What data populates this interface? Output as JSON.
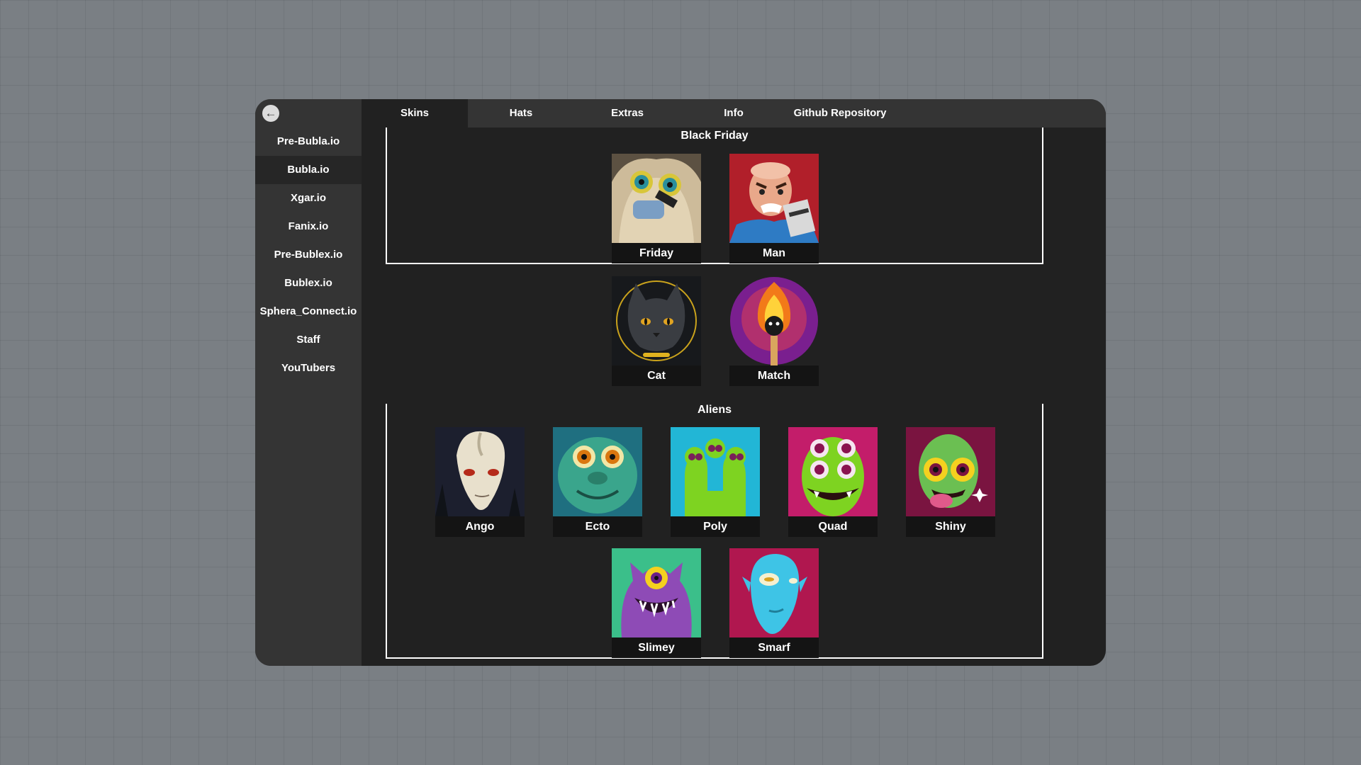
{
  "sidebar": {
    "back_icon": "arrow-left-icon",
    "items": [
      "Pre-Bubla.io",
      "Bubla.io",
      "Xgar.io",
      "Fanix.io",
      "Pre-Bublex.io",
      "Bublex.io",
      "Sphera_Connect.io",
      "Staff",
      "YouTubers"
    ],
    "active": "Bubla.io"
  },
  "tabs": {
    "items": [
      "Skins",
      "Hats",
      "Extras",
      "Info",
      "Github Repository"
    ],
    "active": "Skins"
  },
  "sections": {
    "black_friday": {
      "title": "Black Friday",
      "skins": [
        "Friday",
        "Man"
      ]
    },
    "ungrouped": {
      "skins": [
        "Cat",
        "Match"
      ]
    },
    "aliens": {
      "title": "Aliens",
      "skins": [
        "Ango",
        "Ecto",
        "Poly",
        "Quad",
        "Shiny",
        "Slimey",
        "Smarf"
      ]
    }
  },
  "colors": {
    "window_bg": "#212121",
    "sidebar_bg": "#343434",
    "label_bg": "#141414",
    "page_bg": "#7a7f84"
  }
}
